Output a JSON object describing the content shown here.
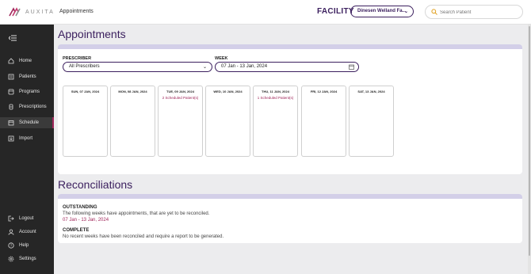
{
  "header": {
    "logo_text": "AUXITA",
    "breadcrumb": "Appointments",
    "facility_label": "FACILITY",
    "facility_select": "Dinesen Welland Fa...",
    "search_placeholder": "Search Patient"
  },
  "sidebar": {
    "items": [
      {
        "label": "Home",
        "icon": "home-icon"
      },
      {
        "label": "Patients",
        "icon": "patients-icon"
      },
      {
        "label": "Programs",
        "icon": "programs-icon"
      },
      {
        "label": "Prescriptions",
        "icon": "prescriptions-icon"
      },
      {
        "label": "Schedule",
        "icon": "schedule-icon",
        "active": true
      },
      {
        "label": "Import",
        "icon": "import-icon"
      }
    ],
    "bottom_items": [
      {
        "label": "Logout",
        "icon": "logout-icon"
      },
      {
        "label": "Account",
        "icon": "account-icon"
      },
      {
        "label": "Help",
        "icon": "help-icon"
      },
      {
        "label": "Settings",
        "icon": "settings-icon"
      }
    ]
  },
  "appointments": {
    "title": "Appointments",
    "prescriber_label": "PRESCRIBER",
    "prescriber_value": "All Prescribers",
    "week_label": "WEEK",
    "week_value": "07 Jan - 13 Jan, 2024",
    "days": [
      {
        "name": "SUN, 07 JAN, 2024",
        "count": ""
      },
      {
        "name": "MON, 08 JAN, 2024",
        "count": ""
      },
      {
        "name": "TUE, 09 JAN, 2024",
        "count": "2 Scheduled Patient(s)"
      },
      {
        "name": "WED, 10 JAN, 2024",
        "count": ""
      },
      {
        "name": "THU, 11 JAN, 2024",
        "count": "1 Scheduled Patient(s)"
      },
      {
        "name": "FRI, 12 JAN, 2024",
        "count": ""
      },
      {
        "name": "SAT, 13 JAN, 2024",
        "count": ""
      }
    ]
  },
  "reconciliations": {
    "title": "Reconciliations",
    "outstanding_title": "OUTSTANDING",
    "outstanding_text": "The following weeks have appointments, that are yet to be reconciled.",
    "outstanding_link": "07 Jan - 13 Jan, 2024",
    "complete_title": "COMPLETE",
    "complete_text": "No recent weeks have been reconciled and require a report to be generated."
  },
  "colors": {
    "brand": "#3b1f5e",
    "accent": "#a0265a",
    "band": "#d3cfe8",
    "sidebar": "#262626"
  }
}
